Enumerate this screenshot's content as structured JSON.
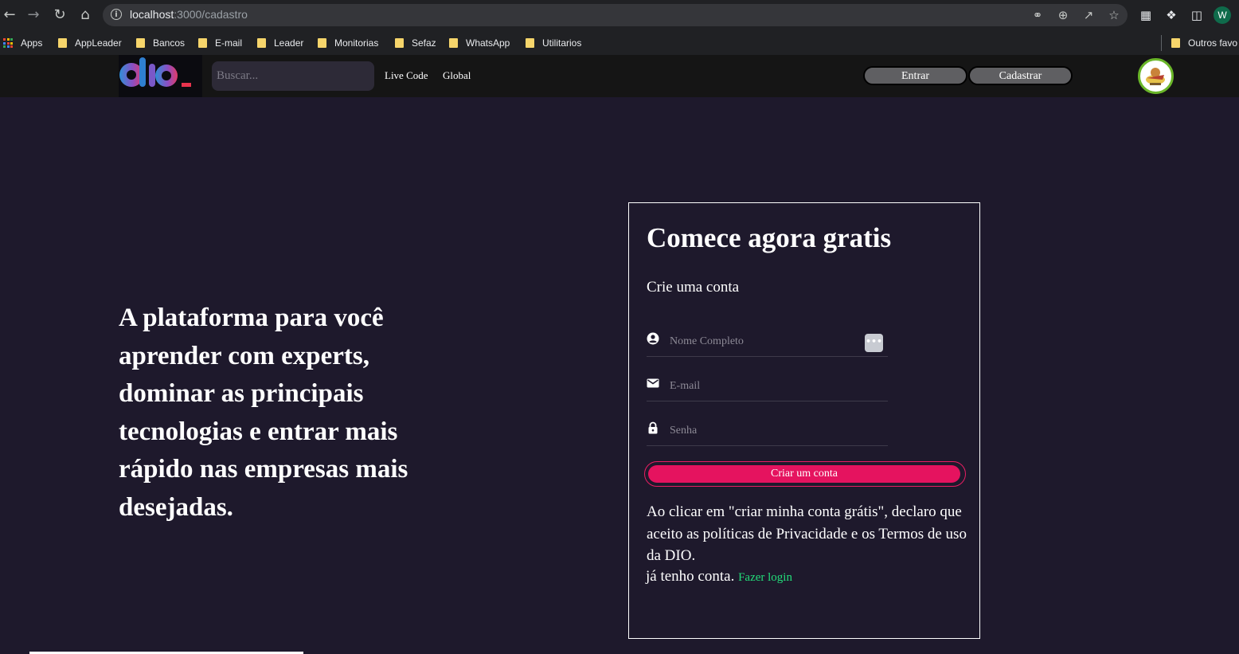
{
  "browser": {
    "url_host": "localhost",
    "url_path": ":3000/cadastro",
    "profile_initial": "W",
    "bookmarks": [
      {
        "label": "Apps",
        "type": "apps"
      },
      {
        "label": "AppLeader",
        "type": "folder"
      },
      {
        "label": "Bancos",
        "type": "folder"
      },
      {
        "label": "E-mail",
        "type": "folder"
      },
      {
        "label": "Leader",
        "type": "folder"
      },
      {
        "label": "Monitorias",
        "type": "folder"
      },
      {
        "label": "Sefaz",
        "type": "folder"
      },
      {
        "label": "WhatsApp",
        "type": "folder"
      },
      {
        "label": "Utilitarios",
        "type": "folder"
      }
    ],
    "other_bookmarks": "Outros favo"
  },
  "header": {
    "search_placeholder": "Buscar...",
    "links": [
      "Live Code",
      "Global"
    ],
    "enter_label": "Entrar",
    "signup_label": "Cadastrar"
  },
  "hero": {
    "text": "A plataforma para você aprender com experts, dominar as principais tecnologias e entrar mais rápido nas empresas mais desejadas."
  },
  "form": {
    "title": "Comece agora gratis",
    "subtitle": "Crie uma conta",
    "name_placeholder": "Nome Completo",
    "email_placeholder": "E-mail",
    "password_placeholder": "Senha",
    "submit_label": "Criar um conta",
    "terms": "Ao clicar em \"criar minha conta grátis\", declaro que aceito as políticas de Privacidade e os Termos de uso da DIO.",
    "have_account": "já tenho conta.",
    "login_link": "Fazer login"
  },
  "colors": {
    "page_bg": "#1e192c",
    "header_bg": "#151515",
    "cta": "#e5135f",
    "link_green": "#23dd7a"
  }
}
